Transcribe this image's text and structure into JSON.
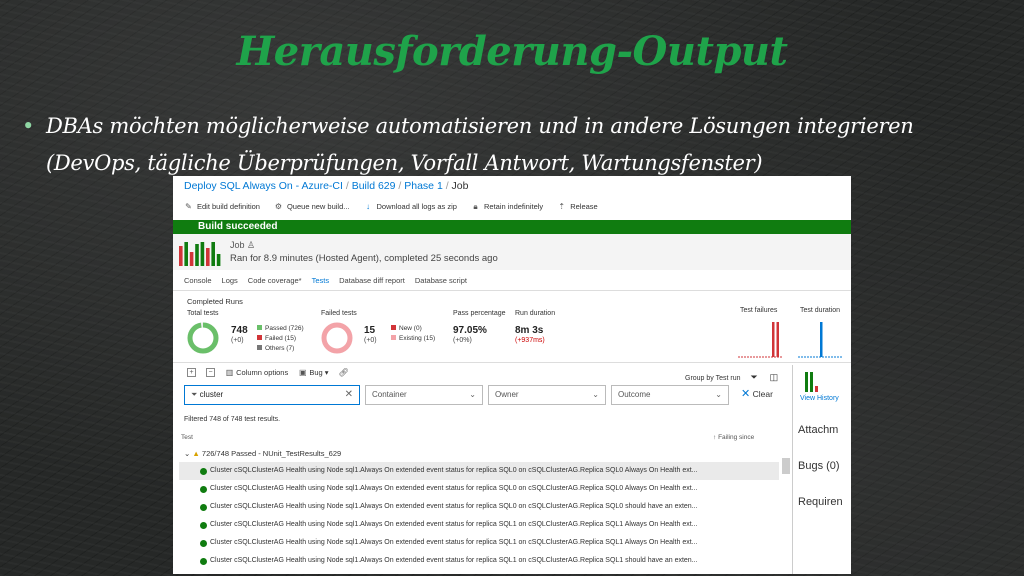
{
  "slide": {
    "title": "Herausforderung-Output",
    "bullet": "DBAs möchten möglicherweise automatisieren und in andere Lösungen integrieren (DevOps, tägliche Überprüfungen, Vorfall Antwort, Wartungsfenster)"
  },
  "breadcrumb": {
    "items": [
      "Deploy SQL Always On - Azure-CI",
      "Build 629",
      "Phase 1"
    ],
    "current": "Job",
    "separator": "/"
  },
  "toolbar": {
    "edit": "Edit build definition",
    "queue": "Queue new build...",
    "download": "Download all logs as zip",
    "retain": "Retain indefinitely",
    "release": "Release"
  },
  "banner": {
    "text": "Build succeeded",
    "color": "#107c10"
  },
  "job": {
    "name": "Job",
    "summary": "Ran for 8.9 minutes (Hosted Agent), completed 25 seconds ago",
    "history_bars": [
      "red",
      "green",
      "red",
      "green",
      "green",
      "red",
      "green",
      "green"
    ]
  },
  "tabs": [
    "Console",
    "Logs",
    "Code coverage*",
    "Tests",
    "Database diff report",
    "Database script"
  ],
  "active_tab": "Tests",
  "summary": {
    "title": "Completed Runs",
    "total": {
      "label": "Total tests",
      "value": "748",
      "delta": "(+0)"
    },
    "legend": {
      "passed": "Passed (726)",
      "failed": "Failed (15)",
      "others": "Others (7)"
    },
    "failed": {
      "label": "Failed tests",
      "value": "15",
      "delta": "(+0)"
    },
    "failed_legend": {
      "new": "New (0)",
      "existing": "Existing (15)"
    },
    "pass_pct": {
      "label": "Pass percentage",
      "value": "97.05%",
      "delta": "(+0%)"
    },
    "duration": {
      "label": "Run duration",
      "value": "8m 3s",
      "delta": "(+937ms)"
    },
    "test_failures_label": "Test failures",
    "test_duration_label": "Test duration",
    "passed_fraction": 0.9706
  },
  "grid_toolbar": {
    "column_options": "Column options",
    "bug": "Bug",
    "group_by": "Group by Test run"
  },
  "filters": {
    "search_value": "cluster",
    "container": "Container",
    "owner": "Owner",
    "outcome": "Outcome",
    "clear": "Clear"
  },
  "filtered_text": "Filtered 748 of 748 test results.",
  "columns": {
    "test": "Test",
    "failing_since": "Failing since"
  },
  "group_label": "726/748 Passed - NUnit_TestResults_629",
  "rows": [
    "Cluster cSQLClusterAG Health using Node sql1.Always On extended event status for replica SQL0 on cSQLClusterAG.Replica SQL0 Always On Health ext...",
    "Cluster cSQLClusterAG Health using Node sql1.Always On extended event status for replica SQL0 on cSQLClusterAG.Replica SQL0 Always On Health ext...",
    "Cluster cSQLClusterAG Health using Node sql1.Always On extended event status for replica SQL0 on cSQLClusterAG.Replica SQL0 should have an exten...",
    "Cluster cSQLClusterAG Health using Node sql1.Always On extended event status for replica SQL1 on cSQLClusterAG.Replica SQL1 Always On Health ext...",
    "Cluster cSQLClusterAG Health using Node sql1.Always On extended event status for replica SQL1 on cSQLClusterAG.Replica SQL1 Always On Health ext...",
    "Cluster cSQLClusterAG Health using Node sql1.Always On extended event status for replica SQL1 on cSQLClusterAG.Replica SQL1 should have an exten..."
  ],
  "right_panel": {
    "view_history": "View History",
    "attachments": "Attachm",
    "bugs": "Bugs (0)",
    "requirements": "Requiren"
  }
}
